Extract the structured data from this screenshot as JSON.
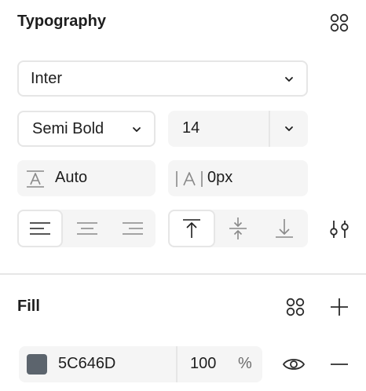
{
  "typography": {
    "title": "Typography",
    "styles_icon": "styles-grid-icon",
    "font_family": "Inter",
    "font_weight": "Semi Bold",
    "font_size": "14",
    "line_height": "Auto",
    "letter_spacing": "0px",
    "line_height_icon": "line-height-icon",
    "letter_spacing_icon": "letter-spacing-icon",
    "align_horizontal": [
      "align-left",
      "align-center",
      "align-right"
    ],
    "align_horizontal_selected": "align-left",
    "align_vertical": [
      "align-top",
      "align-middle",
      "align-bottom"
    ],
    "align_vertical_selected": "align-top",
    "more_options_icon": "type-settings-icon"
  },
  "fill": {
    "title": "Fill",
    "styles_icon": "styles-grid-icon",
    "add_icon": "plus-icon",
    "swatch_color": "#5C646D",
    "hex": "5C646D",
    "opacity": "100",
    "opacity_unit": "%",
    "visibility_icon": "eye-icon",
    "remove_icon": "minus-icon"
  },
  "colors": {
    "border": "#e6e6e6",
    "field_bg": "#f5f5f5",
    "text": "#1e1e1e",
    "icon": "#2b2b2b",
    "muted_icon": "#8a8a8a"
  }
}
